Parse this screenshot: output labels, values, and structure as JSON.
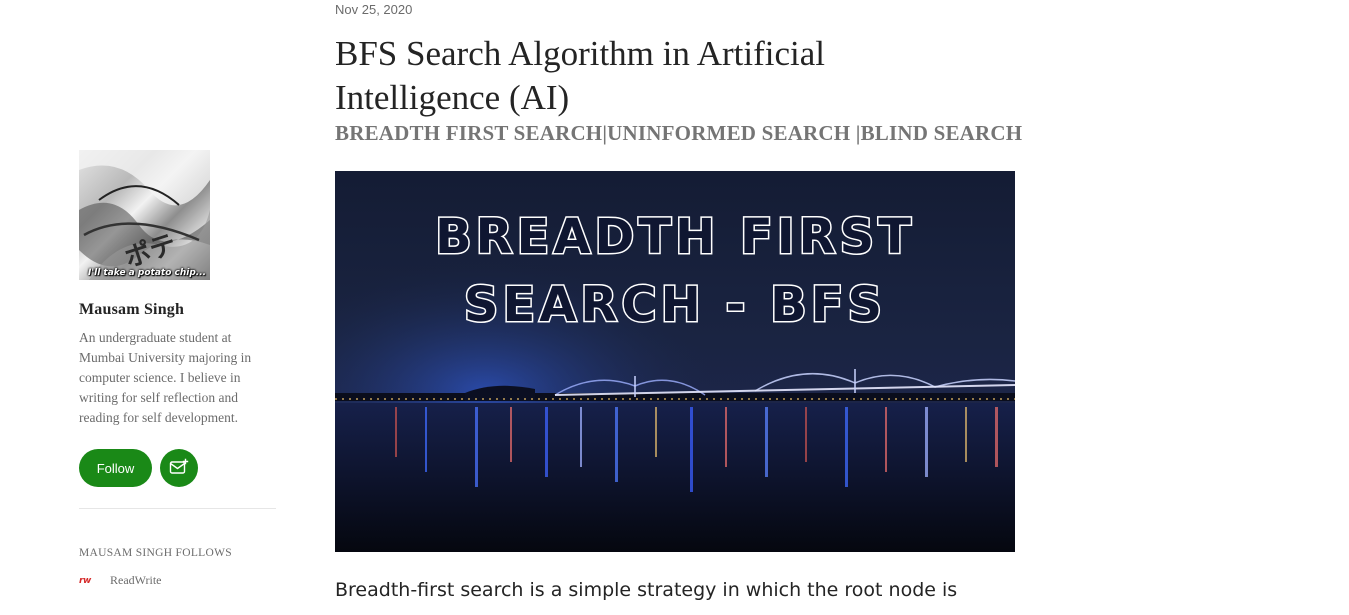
{
  "author": {
    "avatar_caption": "I'll take a potato chip...",
    "name": "Mausam Singh",
    "bio": "An undergraduate student at Mumbai University majoring in computer science. I believe in writing for self reflection and reading for self development.",
    "follow_label": "Follow",
    "subscribe_icon": "mail-plus-icon"
  },
  "follows": {
    "heading": "MAUSAM SINGH FOLLOWS",
    "items": [
      {
        "logo": "rw",
        "label": "ReadWrite"
      }
    ]
  },
  "article": {
    "date": "Nov 25, 2020",
    "title": "BFS Search Algorithm in Artificial Intelligence (AI)",
    "subtitle": "BREADTH FIRST SEARCH|UNINFORMED SEARCH |BLIND SEARCH",
    "hero_line1": "BREADTH FIRST",
    "hero_line2": "SEARCH - BFS",
    "body_first_line": "Breadth-first search is a simple strategy in which the root node is"
  },
  "colors": {
    "accent": "#1a8917",
    "text": "#242424",
    "muted": "#6b6b6b",
    "hero_bg": "#141c34"
  }
}
